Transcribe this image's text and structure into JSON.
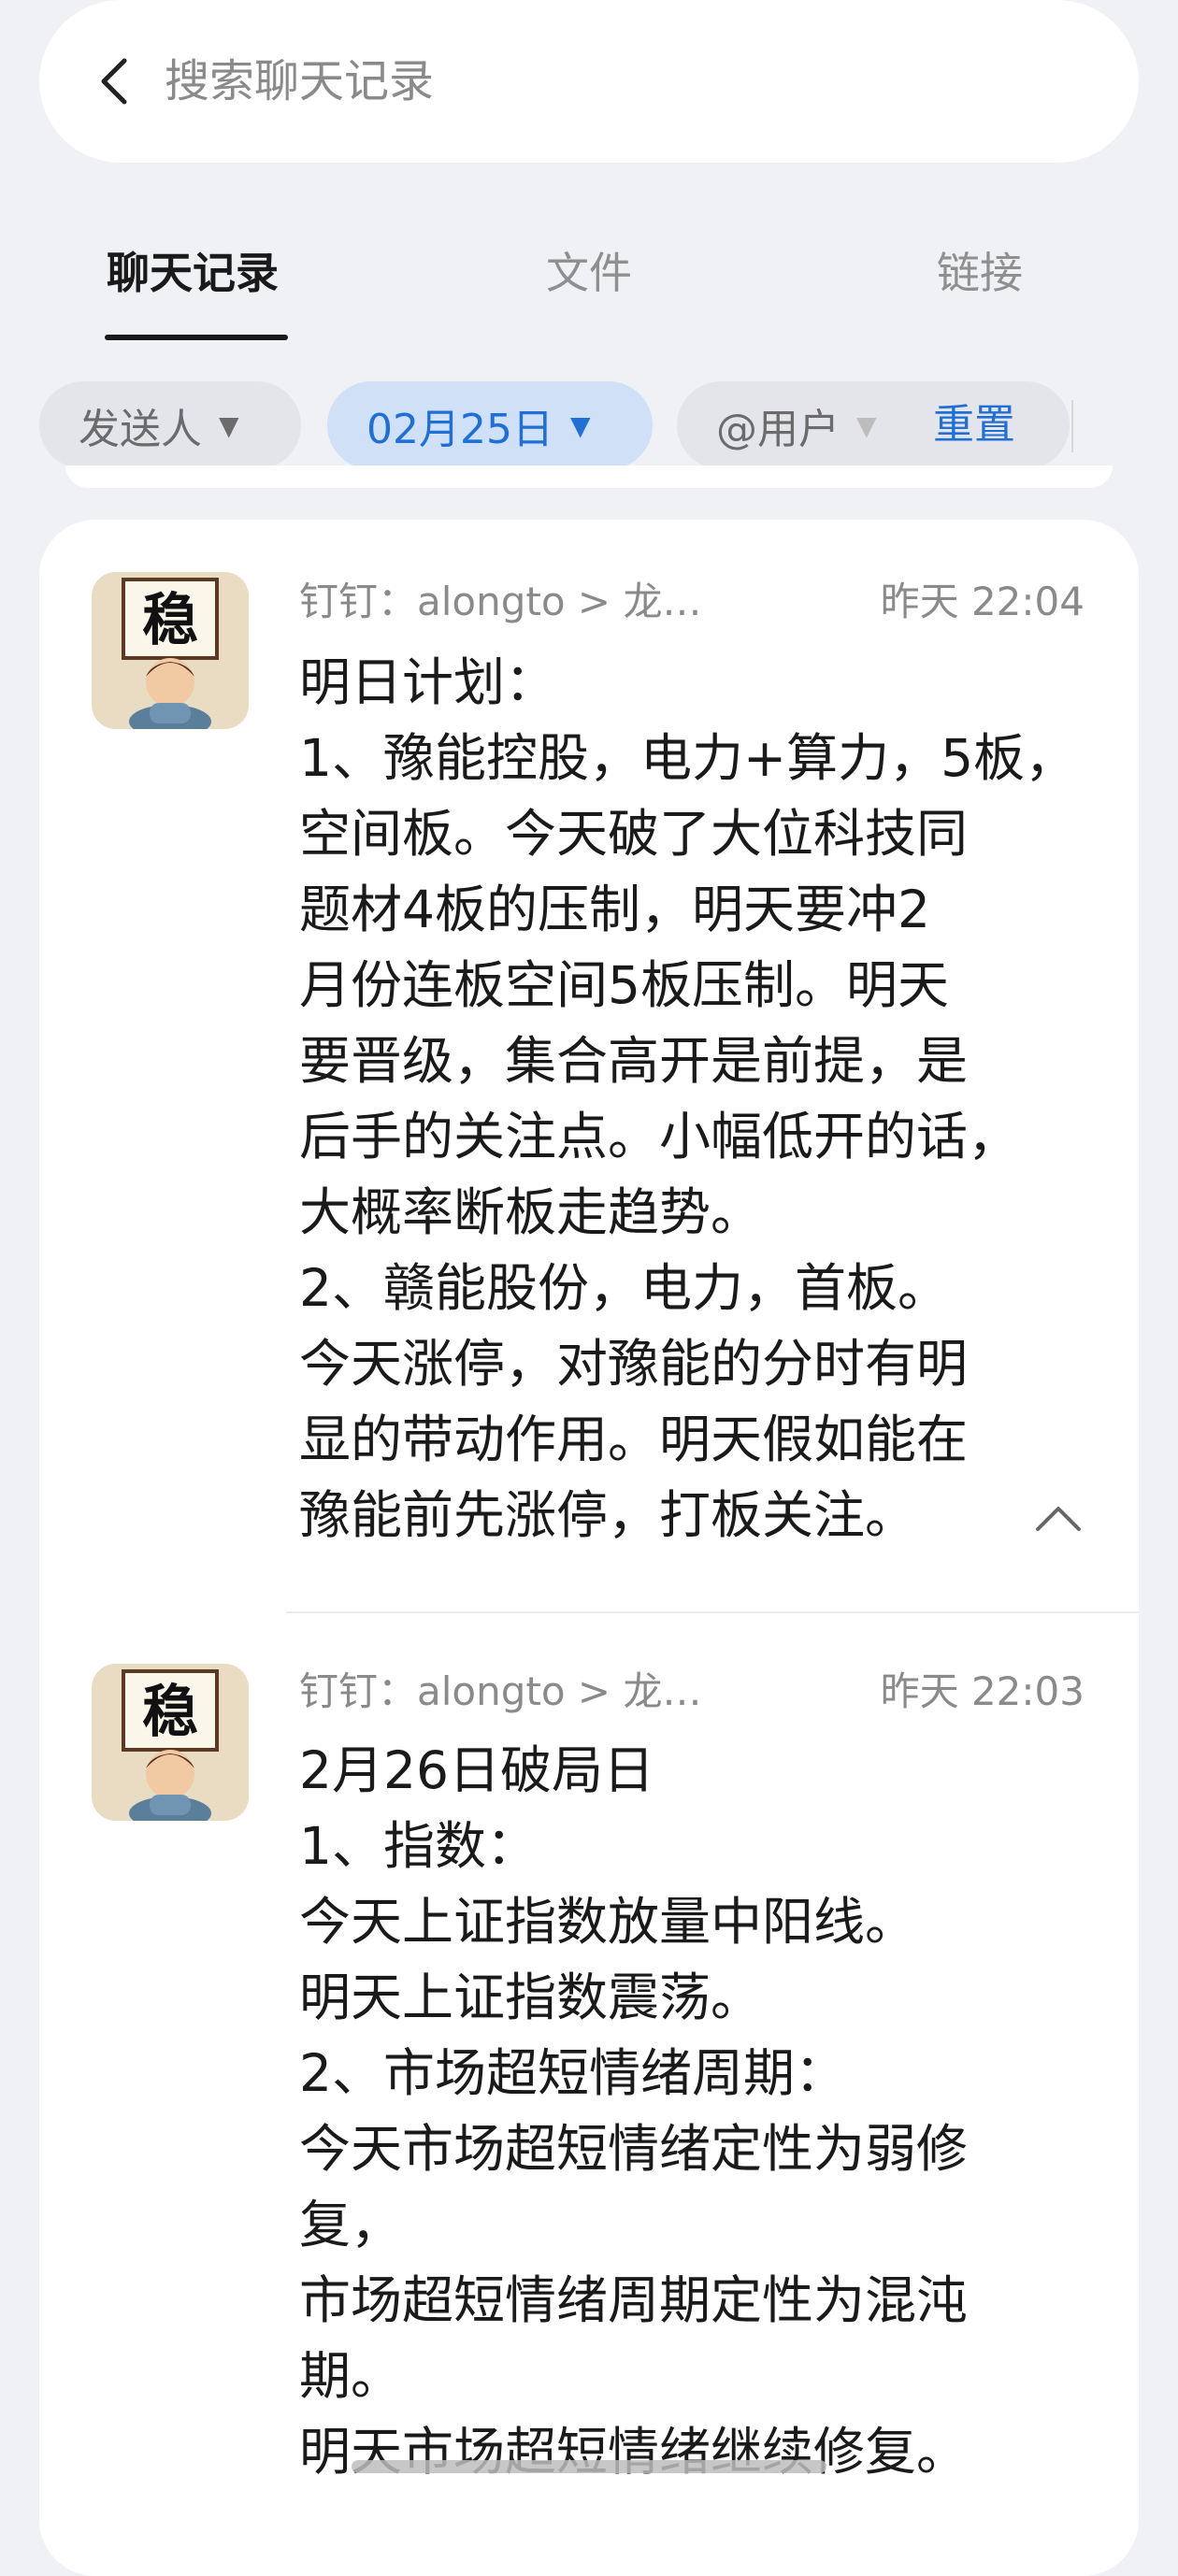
{
  "search": {
    "placeholder": "搜索聊天记录"
  },
  "tabs": [
    {
      "label": "聊天记录",
      "active": true
    },
    {
      "label": "文件",
      "active": false
    },
    {
      "label": "链接",
      "active": false
    }
  ],
  "filters": {
    "sender": "发送人",
    "date": "02月25日",
    "user": "@用户",
    "reset": "重置"
  },
  "avatar_char": "稳",
  "messages": [
    {
      "sender": "钉钉：alongto > 龙…",
      "time": "昨天 22:04",
      "lines": [
        "明日计划：",
        "1、豫能控股，电力+算力，5板，",
        "空间板。今天破了大位科技同",
        "题材4板的压制，明天要冲2",
        "月份连板空间5板压制。明天",
        "要晋级，集合高开是前提，是",
        "后手的关注点。小幅低开的话，",
        "大概率断板走趋势。",
        "2、赣能股份，电力，首板。",
        "今天涨停，对豫能的分时有明",
        "显的带动作用。明天假如能在",
        "豫能前先涨停，打板关注。"
      ]
    },
    {
      "sender": "钉钉：alongto > 龙…",
      "time": "昨天 22:03",
      "lines": [
        "2月26日破局日",
        "1、指数：",
        "今天上证指数放量中阳线。",
        "明天上证指数震荡。",
        "2、市场超短情绪周期：",
        "今天市场超短情绪定性为弱修",
        "复，",
        "市场超短情绪周期定性为混沌",
        "期。",
        "明天市场超短情绪继续修复。"
      ]
    }
  ],
  "colors": {
    "accent": "#1f6fd6",
    "chip_active_bg": "#cfe0f7",
    "background": "#f0f1f5"
  }
}
